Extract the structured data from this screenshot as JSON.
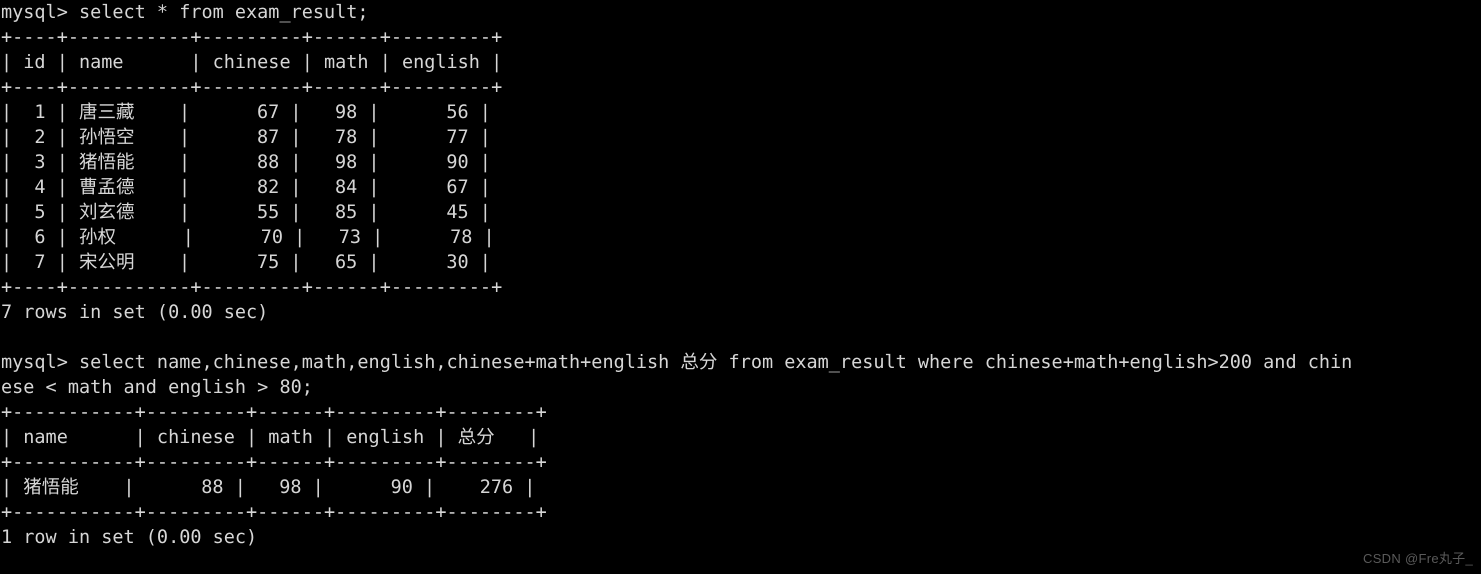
{
  "terminal": {
    "prompt": "mysql> ",
    "background_color": "#000000",
    "text_color": "#d6d6d6",
    "watermark": "CSDN @Fre丸子_",
    "queries": [
      {
        "command": "mysql> select * from exam_result;",
        "status": "7 rows in set (0.00 sec)"
      },
      {
        "command_line_1": "mysql> select name,chinese,math,english,chinese+math+english 总分 from exam_result where chinese+math+english>200 and chin",
        "command_line_2": "ese < math and english > 80;",
        "status": "1 row in set (0.00 sec)"
      }
    ],
    "table1": {
      "border": "+----+-----------+---------+------+---------+",
      "header_row": "| id | name      | chinese | math | english |",
      "headers": [
        "id",
        "name",
        "chinese",
        "math",
        "english"
      ],
      "rows": [
        "|  1 | 唐三藏    |      67 |   98 |      56 |",
        "|  2 | 孙悟空    |      87 |   78 |      77 |",
        "|  3 | 猪悟能    |      88 |   98 |      90 |",
        "|  4 | 曹孟德    |      82 |   84 |      67 |",
        "|  5 | 刘玄德    |      55 |   85 |      45 |",
        "|  6 | 孙权      |      70 |   73 |      78 |",
        "|  7 | 宋公明    |      75 |   65 |      30 |"
      ],
      "data": [
        {
          "id": "1",
          "name": "唐三藏",
          "chinese": "67",
          "math": "98",
          "english": "56"
        },
        {
          "id": "2",
          "name": "孙悟空",
          "chinese": "87",
          "math": "78",
          "english": "77"
        },
        {
          "id": "3",
          "name": "猪悟能",
          "chinese": "88",
          "math": "98",
          "english": "90"
        },
        {
          "id": "4",
          "name": "曹孟德",
          "chinese": "82",
          "math": "84",
          "english": "67"
        },
        {
          "id": "5",
          "name": "刘玄德",
          "chinese": "55",
          "math": "85",
          "english": "45"
        },
        {
          "id": "6",
          "name": "孙权",
          "chinese": "70",
          "math": "73",
          "english": "78"
        },
        {
          "id": "7",
          "name": "宋公明",
          "chinese": "75",
          "math": "65",
          "english": "30"
        }
      ]
    },
    "table2": {
      "border": "+-----------+---------+------+---------+--------+",
      "header_row": "| name      | chinese | math | english | 总分   |",
      "headers": [
        "name",
        "chinese",
        "math",
        "english",
        "总分"
      ],
      "rows": [
        "| 猪悟能    |      88 |   98 |      90 |    276 |"
      ],
      "data": [
        {
          "name": "猪悟能",
          "chinese": "88",
          "math": "98",
          "english": "90",
          "total": "276"
        }
      ]
    }
  }
}
